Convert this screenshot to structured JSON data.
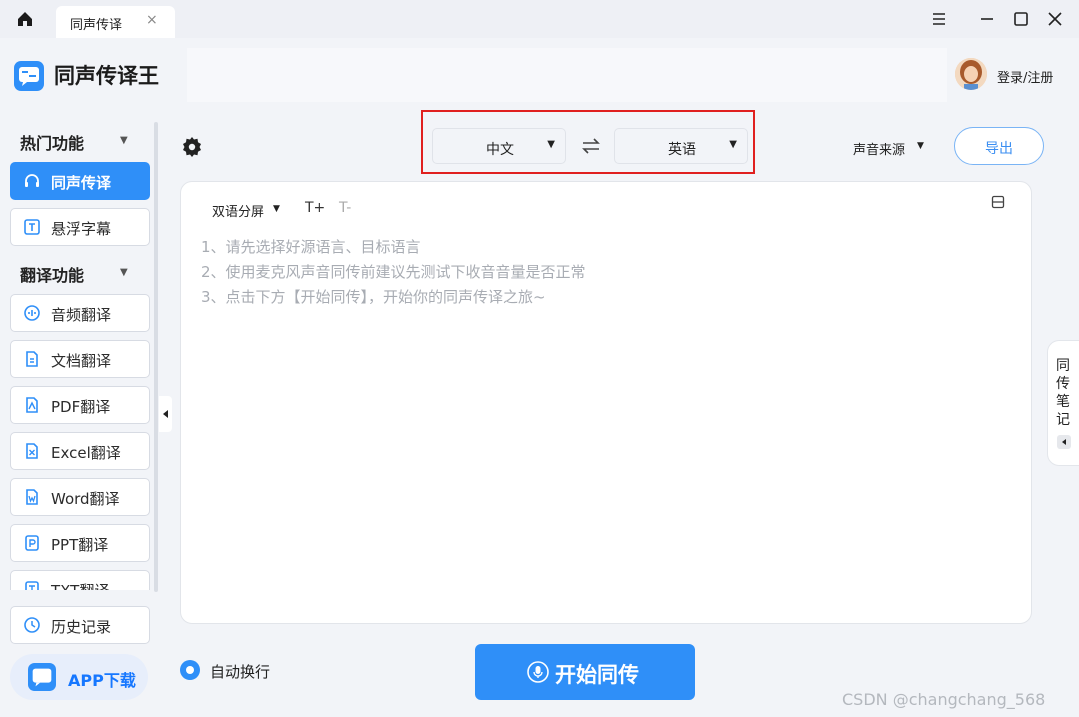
{
  "titlebar": {
    "tab_label": "同声传译",
    "tab_close": "×",
    "icons": [
      "home-icon",
      "menu-icon",
      "minimize-icon",
      "maximize-icon",
      "close-icon"
    ]
  },
  "header": {
    "app_title": "同声传译王",
    "login_label": "登录/注册"
  },
  "sidebar": {
    "popular_title": "热门功能",
    "translate_title": "翻译功能",
    "popular_items": [
      {
        "label": "同声传译",
        "icon": "headset-icon",
        "active": true
      },
      {
        "label": "悬浮字幕",
        "icon": "subtitle-icon",
        "active": false
      }
    ],
    "translate_items": [
      {
        "label": "音频翻译",
        "icon": "audio-icon"
      },
      {
        "label": "文档翻译",
        "icon": "document-icon"
      },
      {
        "label": "PDF翻译",
        "icon": "pdf-icon"
      },
      {
        "label": "Excel翻译",
        "icon": "excel-icon"
      },
      {
        "label": "Word翻译",
        "icon": "word-icon"
      },
      {
        "label": "PPT翻译",
        "icon": "ppt-icon"
      },
      {
        "label": "TXT翻译",
        "icon": "txt-icon"
      }
    ],
    "history_label": "历史记录",
    "app_download_label": "APP下载"
  },
  "toolbar": {
    "source_lang": "中文",
    "target_lang": "英语",
    "sound_source_label": "声音来源",
    "export_label": "导出"
  },
  "content": {
    "view_mode_label": "双语分屏",
    "font_increase": "T+",
    "font_decrease": "T-",
    "hints": [
      "1、请先选择好源语言、目标语言",
      "2、使用麦克风声音同传前建议先测试下收音音量是否正常",
      "3、点击下方【开始同传】，开始你的同声传译之旅~"
    ]
  },
  "notes_tab": {
    "label": "同传笔记"
  },
  "bottom": {
    "auto_wrap_label": "自动换行",
    "auto_wrap_checked": true,
    "start_label": "开始同传"
  },
  "watermark": "CSDN @changchang_568",
  "colors": {
    "accent": "#2f8ff8",
    "highlight_border": "#e0201f"
  }
}
